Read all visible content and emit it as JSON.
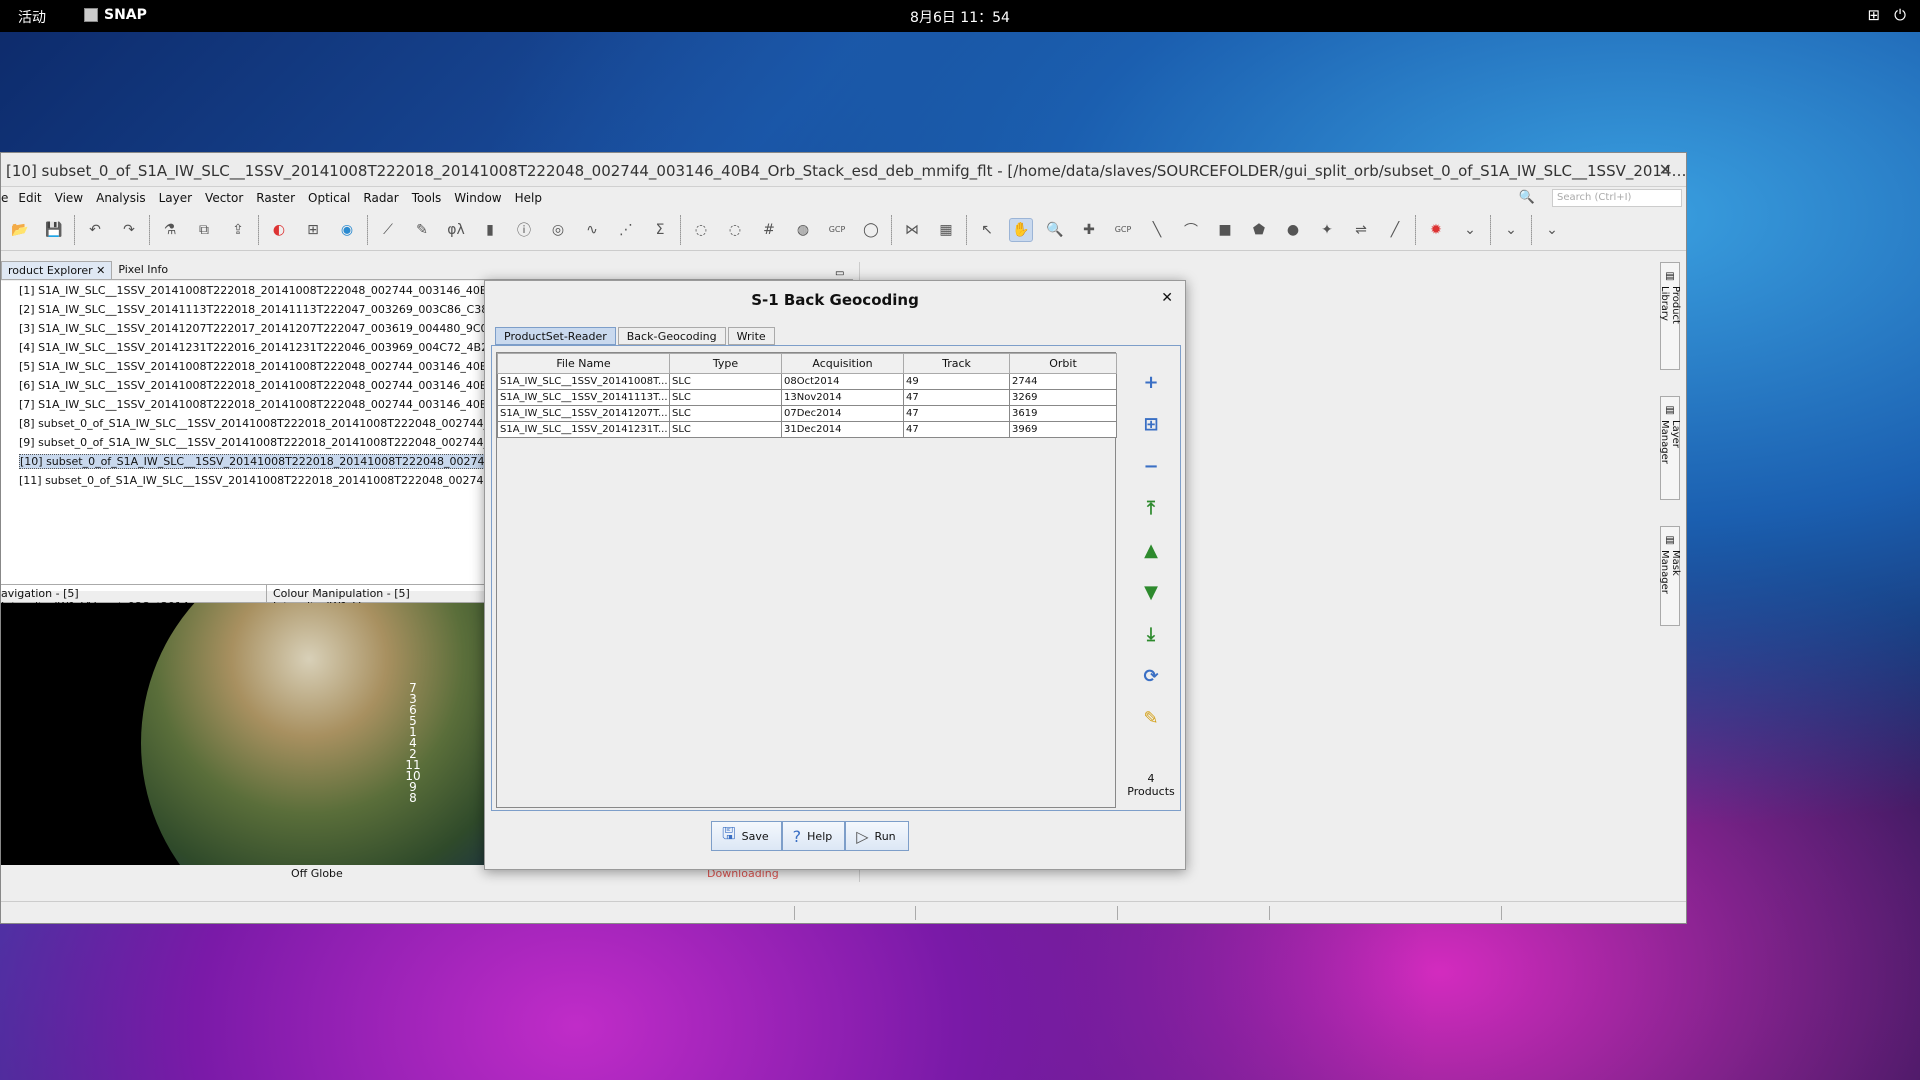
{
  "topbar": {
    "activities": "活动",
    "app_name": "SNAP",
    "clock": "8月6日 11：54"
  },
  "window": {
    "title": "[10] subset_0_of_S1A_IW_SLC__1SSV_20141008T222018_20141008T222048_002744_003146_40B4_Orb_Stack_esd_deb_mmifg_flt - [/home/data/slaves/SOURCEFOLDER/gui_split_orb/subset_0_of_S1A_IW_SLC__1SSV_2014…",
    "menu": [
      "e",
      "Edit",
      "View",
      "Analysis",
      "Layer",
      "Vector",
      "Raster",
      "Optical",
      "Radar",
      "Tools",
      "Window",
      "Help"
    ],
    "search_placeholder": "Search (Ctrl+I)"
  },
  "left": {
    "tabs": [
      "roduct Explorer",
      "Pixel Info"
    ],
    "products": [
      "[1] S1A_IW_SLC__1SSV_20141008T222018_20141008T222048_002744_003146_40B4_Orb",
      "[2] S1A_IW_SLC__1SSV_20141113T222018_20141113T222047_003269_003C86_C381_Orb",
      "[3] S1A_IW_SLC__1SSV_20141207T222017_20141207T222047_003619_004480_9C01_Orb",
      "[4] S1A_IW_SLC__1SSV_20141231T222016_20141231T222046_003969_004C72_4B2C_Orb",
      "[5] S1A_IW_SLC__1SSV_20141008T222018_20141008T222048_002744_003146_40B4_Orb",
      "[6] S1A_IW_SLC__1SSV_20141008T222018_20141008T222048_002744_003146_40B4_Orb",
      "[7] S1A_IW_SLC__1SSV_20141008T222018_20141008T222048_002744_003146_40B4_Orb",
      "[8] subset_0_of_S1A_IW_SLC__1SSV_20141008T222018_20141008T222048_002744_003",
      "[9] subset_0_of_S1A_IW_SLC__1SSV_20141008T222018_20141008T222048_002744_003",
      "[10] subset_0_of_S1A_IW_SLC__1SSV_20141008T222018_20141008T222048_002744_003",
      "[11] subset_0_of_S1A_IW_SLC__1SSV_20141008T222018_20141008T222048_002744_003"
    ],
    "nav_tabs": [
      "avigation - [5] Intensity_IW1_VV_mst_08Oct2014",
      "Colour Manipulation - [5] Intensity_IW1_V"
    ],
    "globe_scale": [
      "7",
      "3",
      "6",
      "5",
      "1",
      "4",
      "2",
      "11",
      "10",
      "9",
      "8"
    ],
    "globe_status": "Off Globe",
    "globe_download": "Downloading"
  },
  "sidebar": [
    "Product Library",
    "Layer Manager",
    "Mask Manager"
  ],
  "dialog": {
    "title": "S-1 Back Geocoding",
    "tabs": [
      "ProductSet-Reader",
      "Back-Geocoding",
      "Write"
    ],
    "columns": [
      "File Name",
      "Type",
      "Acquisition",
      "Track",
      "Orbit"
    ],
    "rows": [
      [
        "S1A_IW_SLC__1SSV_20141008T...",
        "SLC",
        "08Oct2014",
        "49",
        "2744"
      ],
      [
        "S1A_IW_SLC__1SSV_20141113T...",
        "SLC",
        "13Nov2014",
        "47",
        "3269"
      ],
      [
        "S1A_IW_SLC__1SSV_20141207T...",
        "SLC",
        "07Dec2014",
        "47",
        "3619"
      ],
      [
        "S1A_IW_SLC__1SSV_20141231T...",
        "SLC",
        "31Dec2014",
        "47",
        "3969"
      ]
    ],
    "product_count": "4 Products",
    "buttons": {
      "save": "Save",
      "help": "Help",
      "run": "Run"
    }
  }
}
